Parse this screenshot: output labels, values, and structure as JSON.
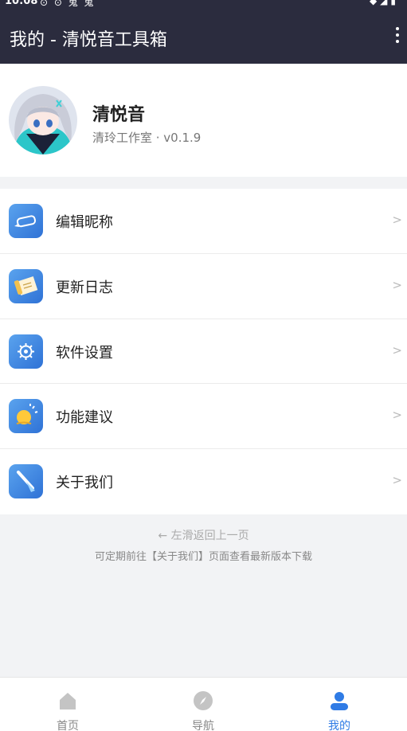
{
  "status_bar": {
    "time": "10:08",
    "left_icons": "⊙ ⊙ 鬼 鬼",
    "right_icons": "◆◢▮"
  },
  "app_bar": {
    "title": "我的 - 清悦音工具箱",
    "more_icon": "more-vertical-icon"
  },
  "profile": {
    "name": "清悦音",
    "subtitle": "清玲工作室 · v0.1.9"
  },
  "menu": [
    {
      "label": "编辑昵称",
      "icon": "edit-pencil-icon",
      "chevron": ">"
    },
    {
      "label": "更新日志",
      "icon": "update-log-icon",
      "chevron": ">"
    },
    {
      "label": "软件设置",
      "icon": "settings-gear-icon",
      "chevron": ">"
    },
    {
      "label": "功能建议",
      "icon": "suggestion-bulb-icon",
      "chevron": ">"
    },
    {
      "label": "关于我们",
      "icon": "about-flag-icon",
      "chevron": ">"
    }
  ],
  "hints": {
    "swipe_back": "← 左滑返回上一页",
    "update_tip": "可定期前往【关于我们】页面查看最新版本下载"
  },
  "tabs": [
    {
      "label": "首页",
      "icon": "home-icon",
      "active": false
    },
    {
      "label": "导航",
      "icon": "compass-icon",
      "active": false
    },
    {
      "label": "我的",
      "icon": "user-icon",
      "active": true
    }
  ],
  "colors": {
    "app_bar": "#2b2c3e",
    "accent": "#2f7be5",
    "icon_gradient_start": "#5aa3ee",
    "icon_gradient_end": "#2f72d6"
  }
}
